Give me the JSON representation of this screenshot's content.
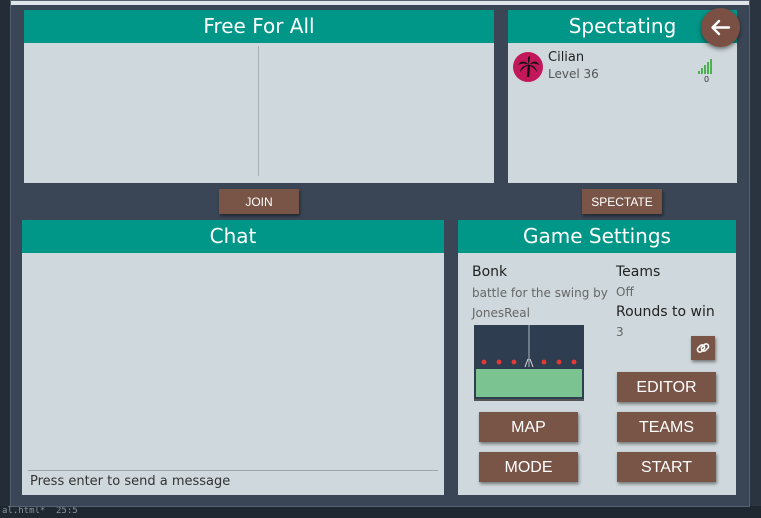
{
  "ffa": {
    "title": "Free For All",
    "join_label": "JOIN"
  },
  "spectating": {
    "title": "Spectating",
    "spectate_label": "SPECTATE",
    "players": [
      {
        "name": "Cilian",
        "level": "Level 36",
        "ping": "0"
      }
    ]
  },
  "chat": {
    "title": "Chat",
    "input_placeholder": "Press enter to send a message"
  },
  "settings": {
    "title": "Game Settings",
    "mode_name": "Bonk",
    "map_name": "battle for the swing by",
    "map_author": "JonesReal",
    "teams_label": "Teams",
    "teams_value": "Off",
    "rounds_label": "Rounds to win",
    "rounds_value": "3",
    "buttons": {
      "editor": "EDITOR",
      "map": "MAP",
      "teams": "TEAMS",
      "mode": "MODE",
      "start": "START"
    }
  },
  "background_text": {
    "status": "25:5",
    "file": "al.html*"
  },
  "colors": {
    "header": "#009688",
    "button": "#795548",
    "panel": "#cfd8dc",
    "avatar": "#c2185b"
  }
}
